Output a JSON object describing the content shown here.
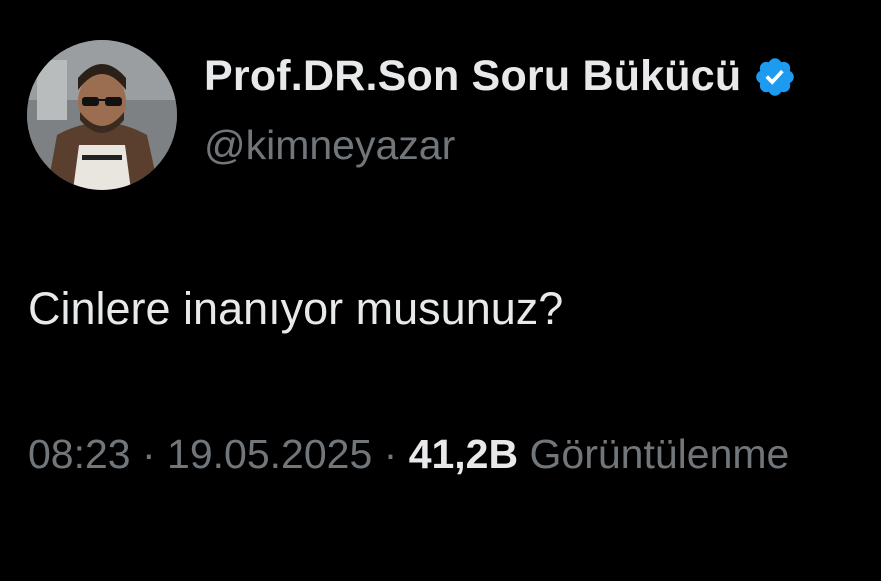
{
  "author": {
    "display_name": "Prof.DR.Son Soru Bükücü",
    "handle": "@kimneyazar",
    "verified_icon": "verified-badge-icon",
    "badge_color": "#1d9bf0"
  },
  "tweet": {
    "text": "Cinlere inanıyor musunuz?",
    "time": "08:23",
    "separator": " · ",
    "date": "19.05.2025",
    "views_count": "41,2B",
    "views_label": "Görüntülenme"
  },
  "colors": {
    "background": "#000000",
    "primary_text": "#e7e9ea",
    "secondary_text": "#71767b"
  }
}
